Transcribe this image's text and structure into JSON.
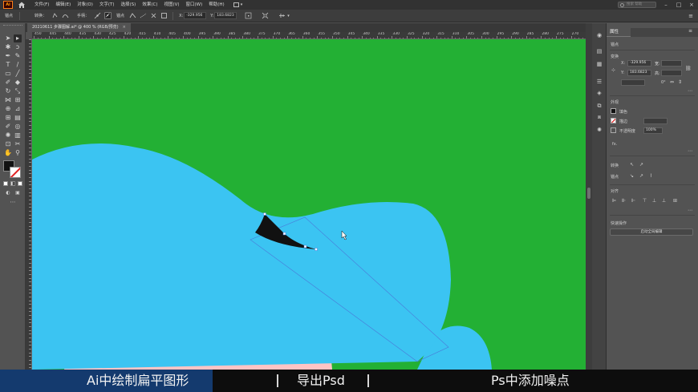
{
  "app": {
    "logo_text": "Ai"
  },
  "menu": {
    "items": [
      "文件(F)",
      "编辑(E)",
      "对象(O)",
      "文字(T)",
      "选择(S)",
      "效果(C)",
      "视图(V)",
      "窗口(W)",
      "帮助(H)"
    ],
    "search_placeholder": "搜索 帮助"
  },
  "control_bar": {
    "anchor_label": "锚点",
    "convert_label": "转换：",
    "handles_label": "手柄：",
    "anchors_label": "锚点",
    "x_label": "X:",
    "x_value": "-329.956",
    "y_label": "Y:",
    "y_value": "183.6823"
  },
  "document": {
    "tab_title": "20210611 步骤图解.ai* @ 400 % (RGB/预览)",
    "close_glyph": "×"
  },
  "ruler": {
    "top_labels": [
      "450",
      "445",
      "440",
      "435",
      "430",
      "425",
      "420",
      "415",
      "410",
      "405",
      "400",
      "395",
      "390",
      "385",
      "380",
      "375",
      "370",
      "365",
      "360",
      "355",
      "350",
      "345",
      "340",
      "335",
      "330",
      "325",
      "320",
      "315",
      "310",
      "305",
      "300",
      "295",
      "290",
      "285",
      "280",
      "275",
      "270",
      "265"
    ]
  },
  "properties": {
    "tab": "属性",
    "selection_type": "锚点",
    "transform_title": "变换",
    "x_label": "X:",
    "x_value": "-329.956",
    "y_label": "Y:",
    "y_value": "183.6823",
    "w_label": "宽:",
    "h_label": "高:",
    "angle_value": "0°",
    "appearance_title": "外观",
    "fill_label": "填色",
    "stroke_label": "描边",
    "opacity_label": "不透明度",
    "opacity_value": "100%",
    "fx_label": "fx.",
    "convert_label": "转换",
    "anchor_label": "锚点",
    "align_title": "对齐",
    "quick_actions_title": "快速操作",
    "quick_action_button": "启动全局编辑"
  },
  "captions": {
    "step1": "Ai中绘制扁平图形",
    "step2": "导出Psd",
    "step3": "Ps中添加噪点"
  },
  "colors": {
    "canvas_bg": "#23b034",
    "blue_shape": "#3bc4f2",
    "pink_shape": "#ffc4c4",
    "dark_shape": "#111111",
    "caption_active": "#143a6e",
    "logo_orange": "#ff9a00"
  }
}
